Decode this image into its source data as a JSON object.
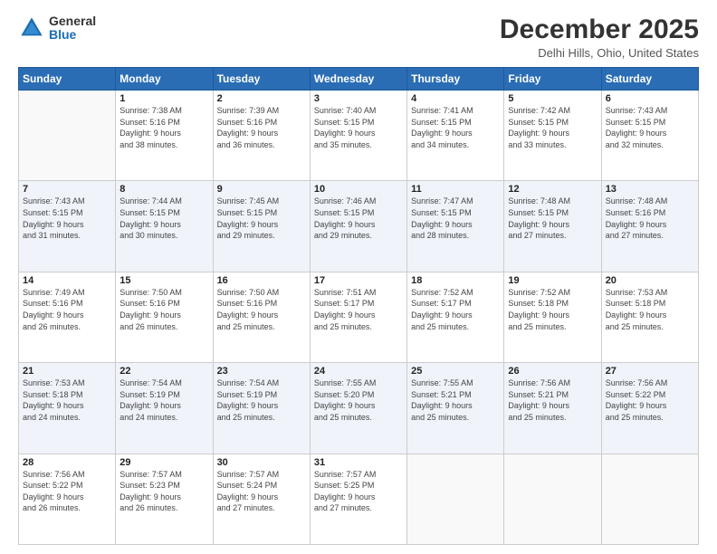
{
  "logo": {
    "general": "General",
    "blue": "Blue"
  },
  "header": {
    "month": "December 2025",
    "location": "Delhi Hills, Ohio, United States"
  },
  "days_of_week": [
    "Sunday",
    "Monday",
    "Tuesday",
    "Wednesday",
    "Thursday",
    "Friday",
    "Saturday"
  ],
  "weeks": [
    [
      {
        "day": "",
        "info": ""
      },
      {
        "day": "1",
        "info": "Sunrise: 7:38 AM\nSunset: 5:16 PM\nDaylight: 9 hours\nand 38 minutes."
      },
      {
        "day": "2",
        "info": "Sunrise: 7:39 AM\nSunset: 5:16 PM\nDaylight: 9 hours\nand 36 minutes."
      },
      {
        "day": "3",
        "info": "Sunrise: 7:40 AM\nSunset: 5:15 PM\nDaylight: 9 hours\nand 35 minutes."
      },
      {
        "day": "4",
        "info": "Sunrise: 7:41 AM\nSunset: 5:15 PM\nDaylight: 9 hours\nand 34 minutes."
      },
      {
        "day": "5",
        "info": "Sunrise: 7:42 AM\nSunset: 5:15 PM\nDaylight: 9 hours\nand 33 minutes."
      },
      {
        "day": "6",
        "info": "Sunrise: 7:43 AM\nSunset: 5:15 PM\nDaylight: 9 hours\nand 32 minutes."
      }
    ],
    [
      {
        "day": "7",
        "info": "Sunrise: 7:43 AM\nSunset: 5:15 PM\nDaylight: 9 hours\nand 31 minutes."
      },
      {
        "day": "8",
        "info": "Sunrise: 7:44 AM\nSunset: 5:15 PM\nDaylight: 9 hours\nand 30 minutes."
      },
      {
        "day": "9",
        "info": "Sunrise: 7:45 AM\nSunset: 5:15 PM\nDaylight: 9 hours\nand 29 minutes."
      },
      {
        "day": "10",
        "info": "Sunrise: 7:46 AM\nSunset: 5:15 PM\nDaylight: 9 hours\nand 29 minutes."
      },
      {
        "day": "11",
        "info": "Sunrise: 7:47 AM\nSunset: 5:15 PM\nDaylight: 9 hours\nand 28 minutes."
      },
      {
        "day": "12",
        "info": "Sunrise: 7:48 AM\nSunset: 5:15 PM\nDaylight: 9 hours\nand 27 minutes."
      },
      {
        "day": "13",
        "info": "Sunrise: 7:48 AM\nSunset: 5:16 PM\nDaylight: 9 hours\nand 27 minutes."
      }
    ],
    [
      {
        "day": "14",
        "info": "Sunrise: 7:49 AM\nSunset: 5:16 PM\nDaylight: 9 hours\nand 26 minutes."
      },
      {
        "day": "15",
        "info": "Sunrise: 7:50 AM\nSunset: 5:16 PM\nDaylight: 9 hours\nand 26 minutes."
      },
      {
        "day": "16",
        "info": "Sunrise: 7:50 AM\nSunset: 5:16 PM\nDaylight: 9 hours\nand 25 minutes."
      },
      {
        "day": "17",
        "info": "Sunrise: 7:51 AM\nSunset: 5:17 PM\nDaylight: 9 hours\nand 25 minutes."
      },
      {
        "day": "18",
        "info": "Sunrise: 7:52 AM\nSunset: 5:17 PM\nDaylight: 9 hours\nand 25 minutes."
      },
      {
        "day": "19",
        "info": "Sunrise: 7:52 AM\nSunset: 5:18 PM\nDaylight: 9 hours\nand 25 minutes."
      },
      {
        "day": "20",
        "info": "Sunrise: 7:53 AM\nSunset: 5:18 PM\nDaylight: 9 hours\nand 25 minutes."
      }
    ],
    [
      {
        "day": "21",
        "info": "Sunrise: 7:53 AM\nSunset: 5:18 PM\nDaylight: 9 hours\nand 24 minutes."
      },
      {
        "day": "22",
        "info": "Sunrise: 7:54 AM\nSunset: 5:19 PM\nDaylight: 9 hours\nand 24 minutes."
      },
      {
        "day": "23",
        "info": "Sunrise: 7:54 AM\nSunset: 5:19 PM\nDaylight: 9 hours\nand 25 minutes."
      },
      {
        "day": "24",
        "info": "Sunrise: 7:55 AM\nSunset: 5:20 PM\nDaylight: 9 hours\nand 25 minutes."
      },
      {
        "day": "25",
        "info": "Sunrise: 7:55 AM\nSunset: 5:21 PM\nDaylight: 9 hours\nand 25 minutes."
      },
      {
        "day": "26",
        "info": "Sunrise: 7:56 AM\nSunset: 5:21 PM\nDaylight: 9 hours\nand 25 minutes."
      },
      {
        "day": "27",
        "info": "Sunrise: 7:56 AM\nSunset: 5:22 PM\nDaylight: 9 hours\nand 25 minutes."
      }
    ],
    [
      {
        "day": "28",
        "info": "Sunrise: 7:56 AM\nSunset: 5:22 PM\nDaylight: 9 hours\nand 26 minutes."
      },
      {
        "day": "29",
        "info": "Sunrise: 7:57 AM\nSunset: 5:23 PM\nDaylight: 9 hours\nand 26 minutes."
      },
      {
        "day": "30",
        "info": "Sunrise: 7:57 AM\nSunset: 5:24 PM\nDaylight: 9 hours\nand 27 minutes."
      },
      {
        "day": "31",
        "info": "Sunrise: 7:57 AM\nSunset: 5:25 PM\nDaylight: 9 hours\nand 27 minutes."
      },
      {
        "day": "",
        "info": ""
      },
      {
        "day": "",
        "info": ""
      },
      {
        "day": "",
        "info": ""
      }
    ]
  ]
}
